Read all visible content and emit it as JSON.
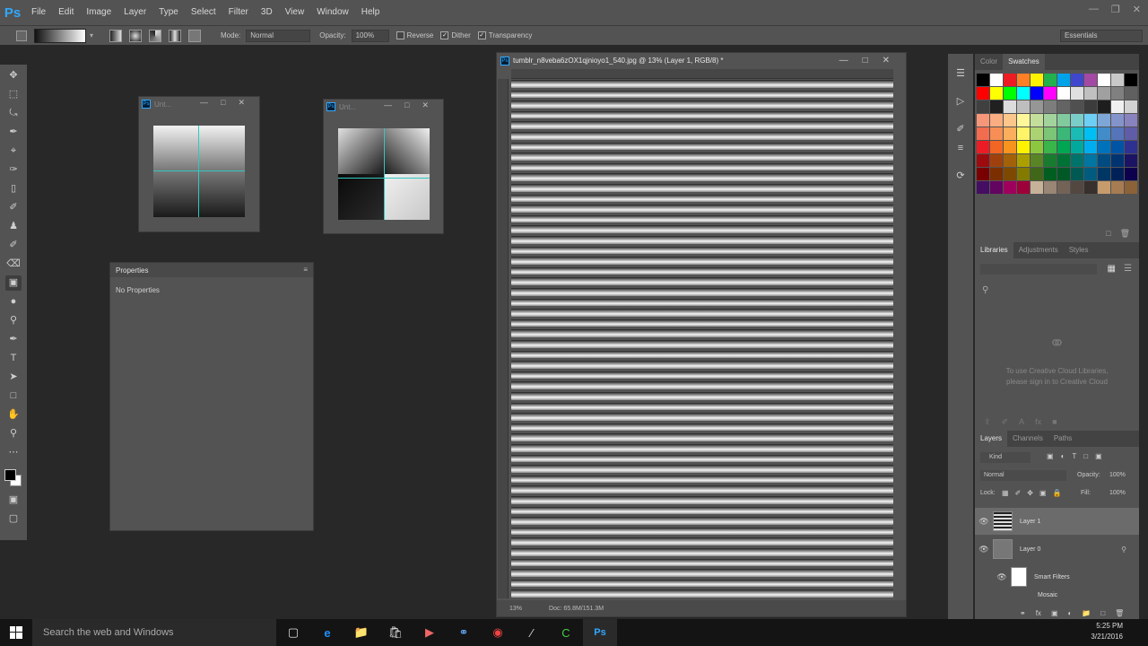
{
  "app": {
    "logo": "Ps"
  },
  "menu": [
    "File",
    "Edit",
    "Image",
    "Layer",
    "Type",
    "Select",
    "Filter",
    "3D",
    "View",
    "Window",
    "Help"
  ],
  "options": {
    "mode_label": "Mode:",
    "mode_value": "Normal",
    "opacity_label": "Opacity:",
    "opacity_value": "100%",
    "reverse": "Reverse",
    "dither": "Dither",
    "transparency": "Transparency",
    "workspace": "Essentials"
  },
  "float_windows": [
    {
      "title": "Unt..."
    },
    {
      "title": "Unt..."
    }
  ],
  "properties": {
    "title": "Properties",
    "body": "No Properties"
  },
  "document": {
    "title": "tumblr_n8veba6zOX1qjnioyo1_540.jpg @ 13% (Layer 1, RGB/8) *",
    "zoom": "13%",
    "doc_info": "Doc: 65.8M/151.3M",
    "stripe_count": 50
  },
  "swatches_panel": {
    "tabs": [
      "Color",
      "Swatches"
    ],
    "colors": [
      "#000000",
      "#ffffff",
      "#ed1c24",
      "#ff7f27",
      "#fff200",
      "#22b14c",
      "#00a2e8",
      "#3f48cc",
      "#a349a4",
      "#ffffff",
      "#c8c8c8",
      "#000000",
      "#ff0000",
      "#ffff00",
      "#00ff00",
      "#00ffff",
      "#0000ff",
      "#ff00ff",
      "#ffffff",
      "#e0e0e0",
      "#c0c0c0",
      "#a0a0a0",
      "#808080",
      "#606060",
      "#404040",
      "#202020",
      "#dcdcdc",
      "#bebebe",
      "#969696",
      "#7d7d7d",
      "#646464",
      "#505050",
      "#3c3c3c",
      "#1e1e1e",
      "#f0f0f0",
      "#d2d2d2",
      "#f7977a",
      "#f9ad81",
      "#fdc68a",
      "#fff79a",
      "#c4df9b",
      "#a2d39c",
      "#82ca9d",
      "#7bcdc8",
      "#6ecff6",
      "#7ea7d8",
      "#8493ca",
      "#8882be",
      "#f26c4f",
      "#f68e55",
      "#fbaf5c",
      "#fff467",
      "#acd372",
      "#7cc576",
      "#3bb878",
      "#1abbb4",
      "#00bff3",
      "#438cca",
      "#5574b9",
      "#605ca8",
      "#ed1c24",
      "#f26522",
      "#f7941d",
      "#fff200",
      "#8dc73f",
      "#39b54a",
      "#00a651",
      "#00a99d",
      "#00aeef",
      "#0072bc",
      "#0054a6",
      "#2e3192",
      "#9e0b0f",
      "#a0410d",
      "#a36209",
      "#aba000",
      "#598527",
      "#197b30",
      "#007236",
      "#00746b",
      "#0076a3",
      "#004b80",
      "#003471",
      "#1b1464",
      "#790000",
      "#7b2e00",
      "#7d4900",
      "#827b00",
      "#406618",
      "#005e20",
      "#005826",
      "#005952",
      "#005b7f",
      "#003663",
      "#002157",
      "#0d004c"
    ],
    "extra": [
      "#440e62",
      "#630460",
      "#9e005d",
      "#9e0039",
      "#c7b299",
      "#998675",
      "#736357",
      "#534741",
      "#37302d",
      "#c69c6d",
      "#a67c52",
      "#8c6239"
    ]
  },
  "libraries_panel": {
    "tabs": [
      "Libraries",
      "Adjustments",
      "Styles"
    ],
    "message_line1": "To use Creative Cloud Libraries,",
    "message_line2": "please sign in to Creative Cloud"
  },
  "layers_panel": {
    "tabs": [
      "Layers",
      "Channels",
      "Paths"
    ],
    "kind": "Kind",
    "blend": "Normal",
    "opacity_label": "Opacity:",
    "opacity_value": "100%",
    "lock_label": "Lock:",
    "fill_label": "Fill:",
    "fill_value": "100%",
    "layers": [
      {
        "name": "Layer 1"
      },
      {
        "name": "Layer 0"
      }
    ],
    "smart_filters": "Smart Filters",
    "mosaic": "Mosaic"
  },
  "taskbar": {
    "search_placeholder": "Search the web and Windows",
    "time": "5:25 PM",
    "date": "3/21/2016"
  }
}
